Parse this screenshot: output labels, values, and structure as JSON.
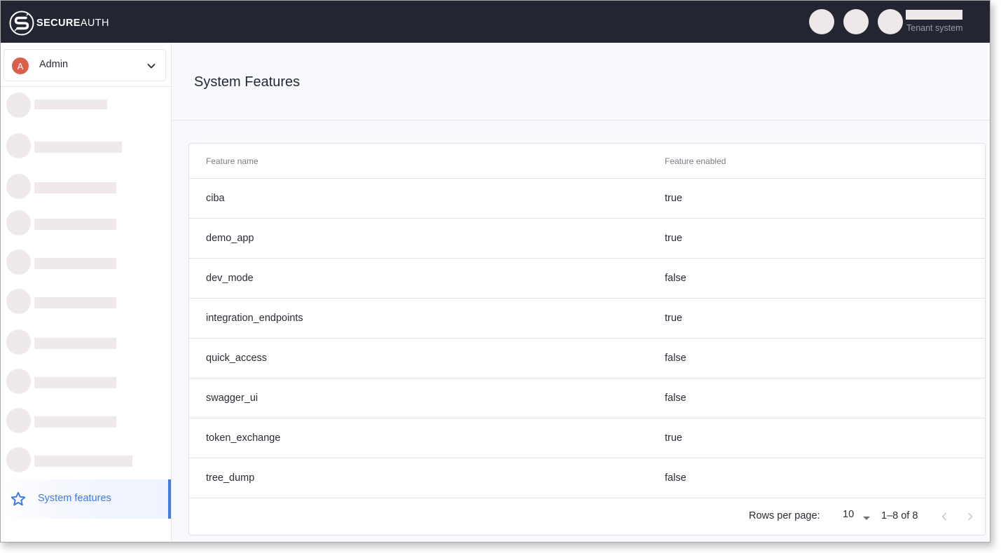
{
  "app": {
    "brand_bold": "SECURE",
    "brand_light": "AUTH",
    "tenant_label": "Tenant system"
  },
  "sidebar": {
    "workspace": {
      "avatar_letter": "A",
      "label": "Admin"
    },
    "active_item": {
      "label": "System features",
      "icon": "star-icon"
    },
    "accent_color": "#3f7ae6"
  },
  "page": {
    "title": "System Features"
  },
  "table": {
    "columns": [
      "Feature name",
      "Feature enabled"
    ],
    "rows": [
      {
        "name": "ciba",
        "enabled": "true"
      },
      {
        "name": "demo_app",
        "enabled": "true"
      },
      {
        "name": "dev_mode",
        "enabled": "false"
      },
      {
        "name": "integration_endpoints",
        "enabled": "true"
      },
      {
        "name": "quick_access",
        "enabled": "false"
      },
      {
        "name": "swagger_ui",
        "enabled": "false"
      },
      {
        "name": "token_exchange",
        "enabled": "true"
      },
      {
        "name": "tree_dump",
        "enabled": "false"
      }
    ]
  },
  "pagination": {
    "rows_per_page_label": "Rows per page:",
    "rows_per_page_value": "10",
    "range_text": "1–8 of 8"
  }
}
